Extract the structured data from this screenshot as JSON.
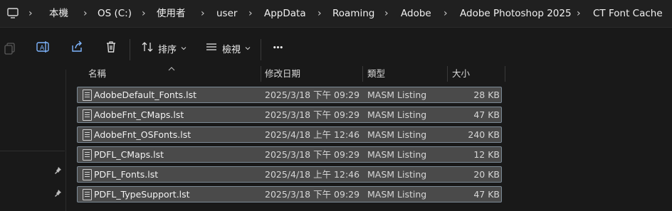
{
  "breadcrumb": {
    "items": [
      "本機",
      "OS (C:)",
      "使用者",
      "user",
      "AppData",
      "Roaming",
      "Adobe",
      "Adobe Photoshop 2025",
      "CT Font Cache"
    ],
    "separator": "›"
  },
  "toolbar": {
    "sort_label": "排序",
    "view_label": "檢視",
    "more_label": "•••"
  },
  "columns": {
    "name": "名稱",
    "modified": "修改日期",
    "type": "類型",
    "size": "大小"
  },
  "files": [
    {
      "name": "AdobeDefault_Fonts.lst",
      "modified": "2025/3/18 下午 09:29",
      "type": "MASM Listing",
      "size": "28 KB"
    },
    {
      "name": "AdobeFnt_CMaps.lst",
      "modified": "2025/3/18 下午 09:29",
      "type": "MASM Listing",
      "size": "47 KB"
    },
    {
      "name": "AdobeFnt_OSFonts.lst",
      "modified": "2025/4/18 上午 12:46",
      "type": "MASM Listing",
      "size": "240 KB"
    },
    {
      "name": "PDFL_CMaps.lst",
      "modified": "2025/3/18 下午 09:29",
      "type": "MASM Listing",
      "size": "12 KB"
    },
    {
      "name": "PDFL_Fonts.lst",
      "modified": "2025/4/18 上午 12:46",
      "type": "MASM Listing",
      "size": "20 KB"
    },
    {
      "name": "PDFL_TypeSupport.lst",
      "modified": "2025/3/18 下午 09:29",
      "type": "MASM Listing",
      "size": "47 KB"
    }
  ],
  "colors": {
    "background": "#191919",
    "row_selected": "#4a4a4a",
    "row_border": "#7c8a96"
  }
}
